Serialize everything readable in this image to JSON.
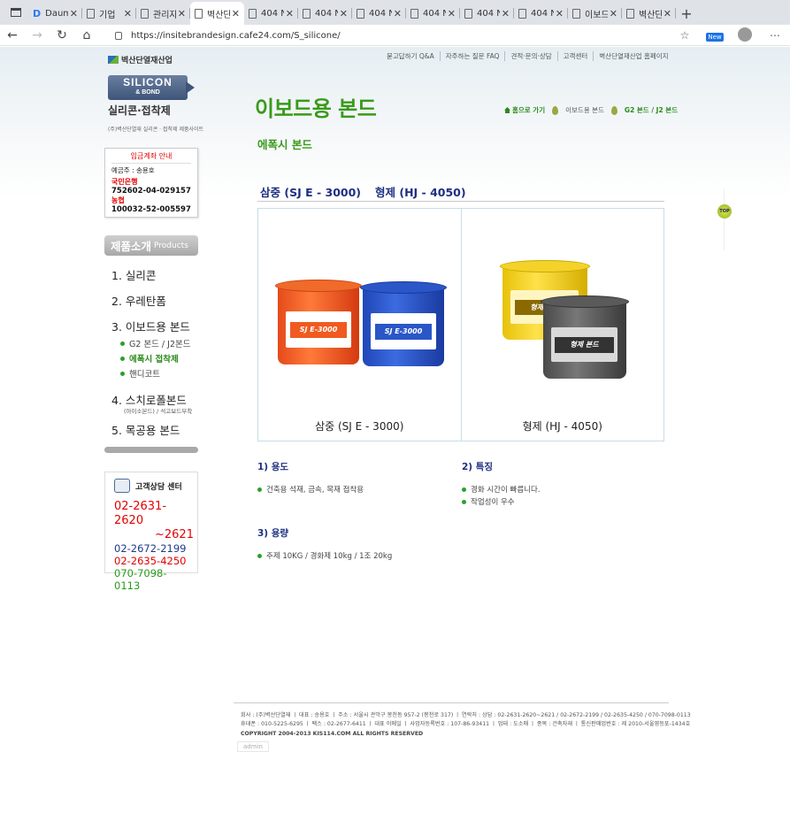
{
  "browser": {
    "tabs": [
      {
        "label": "Daum",
        "icon": "daum-icon",
        "active": false
      },
      {
        "label": "기업",
        "icon": "page-icon",
        "active": false
      },
      {
        "label": "관리자",
        "icon": "page-icon",
        "active": false
      },
      {
        "label": "벽산단",
        "icon": "page-icon",
        "active": true
      },
      {
        "label": "404 N",
        "icon": "page-icon",
        "active": false
      },
      {
        "label": "404 N",
        "icon": "page-icon",
        "active": false
      },
      {
        "label": "404 N",
        "icon": "page-icon",
        "active": false
      },
      {
        "label": "404 N",
        "icon": "page-icon",
        "active": false
      },
      {
        "label": "404 N",
        "icon": "page-icon",
        "active": false
      },
      {
        "label": "404 N",
        "icon": "page-icon",
        "active": false
      },
      {
        "label": "이보드",
        "icon": "page-icon",
        "active": false
      },
      {
        "label": "벽산단",
        "icon": "page-icon",
        "active": false
      }
    ],
    "url": "https://insitebrandesign.cafe24.com/S_silicone/",
    "new_badge": "New"
  },
  "site": {
    "company_logo": "벽산단열재산업",
    "brand_badge_line1": "SILICON",
    "brand_badge_line2": "& BOND",
    "brand_name": "실리콘·접착제",
    "brand_sub": "(주)벽산단열재 실리콘 · 접착제 제품사이트",
    "top_links": [
      "묻고답하기 Q&A",
      "자주하는 질문 FAQ",
      "견적·문의·상담",
      "고객센터",
      "벽산단열재산업 홈페이지"
    ]
  },
  "bank": {
    "heading": "입금계좌 안내",
    "holder": "예금주 : 송용호",
    "accounts": [
      {
        "bank": "국민은행",
        "number": "752602-04-029157"
      },
      {
        "bank": "농협",
        "number": "100032-52-005597"
      }
    ]
  },
  "products_menu": {
    "heading": "제품소개",
    "heading_en": "Products",
    "items": [
      {
        "label": "1. 실리콘"
      },
      {
        "label": "2. 우레탄폼"
      },
      {
        "label": "3. 이보드용 본드"
      },
      {
        "label": "4. 스치로폴본드"
      },
      {
        "label": "5. 목공용 본드"
      }
    ],
    "subitems": [
      {
        "label": "G2 본드 / J2본드",
        "active": false
      },
      {
        "label": "에폭시 접착제",
        "active": true
      },
      {
        "label": "핸디코트",
        "active": false
      }
    ],
    "note": "(아이소본드) / 석고보드부착"
  },
  "customer_center": {
    "heading": "고객상담 센터",
    "phone1": "02-2631-2620",
    "phone1b": "~2621",
    "phone2": "02-2672-2199",
    "phone3": "02-2635-4250",
    "phone4": "070-7098-0113"
  },
  "main": {
    "title": "이보드용 본드",
    "breadcrumb": {
      "home": "홈으로 가기",
      "level1": "이보드용 본드",
      "current": "G2 본드 / J2 본드"
    },
    "subtitle": "에폭시 본드",
    "product_title_1": "삼중 (SJ E - 3000)",
    "product_title_2": "형제 (HJ - 4050)",
    "products": [
      {
        "name": "삼중 (SJ E - 3000)",
        "bucket_labels": [
          "SJ E-3000",
          "SJ E-3000"
        ]
      },
      {
        "name": "형제 (HJ - 4050)",
        "bucket_labels": [
          "형제 본드",
          "형제 본드"
        ]
      }
    ],
    "usage": {
      "heading": "1) 용도",
      "items": [
        "건축용 석재, 금속, 목재 접착용"
      ]
    },
    "features": {
      "heading": "2) 특징",
      "items": [
        "경화 시간이 빠릅니다.",
        "작업성이 우수"
      ]
    },
    "capacity": {
      "heading": "3) 용량",
      "items": [
        "주제 10KG  /  경화제 10kg  /  1조 20kg"
      ]
    }
  },
  "top_button": "TOP",
  "footer": {
    "line1": "회사 : (주)벽산단열재 ㅣ 대표 : 송용호 ㅣ 주소 : 서울시 관악구 봉천동 957-2 (봉천로 317) ㅣ 연락처 : 상담 : 02-2631-2620~2621 / 02-2672-2199 / 02-2635-4250 / 070-7098-0113",
    "line2": "휴대폰 : 010-5225-6295 ㅣ 팩스 : 02-2677-6411 ㅣ 대표 이메일 ㅣ 사업자등록번호 : 107-86-93411 ㅣ 업태 : 도소매 ㅣ 종목 : 건축자재 ㅣ 통신판매업번호 : 제 2010-서울영등포-1434호",
    "copyright": "COPYRIGHT   2004-2013 KIS114.COM ALL RIGHTS RESERVED",
    "admin": "admin"
  }
}
